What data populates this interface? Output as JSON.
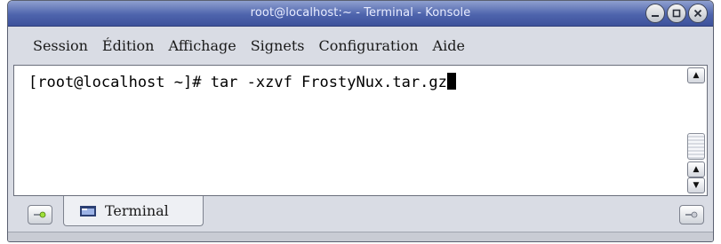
{
  "window": {
    "title": "root@localhost:~ - Terminal - Konsole",
    "controls": {
      "minimize_icon": "minimize-icon",
      "maximize_icon": "maximize-icon",
      "close_icon": "close-icon"
    }
  },
  "menubar": {
    "items": [
      {
        "label": "Session"
      },
      {
        "label": "Édition"
      },
      {
        "label": "Affichage"
      },
      {
        "label": "Signets"
      },
      {
        "label": "Configuration"
      },
      {
        "label": "Aide"
      }
    ]
  },
  "terminal": {
    "prompt": "[root@localhost ~]# ",
    "command": "tar -xzvf FrostyNux.tar.gz"
  },
  "tabs": {
    "active_label": "Terminal",
    "icon": "terminal-icon"
  },
  "colors": {
    "titlebar": "#4e64ad",
    "window_bg": "#d9dce4",
    "terminal_bg": "#ffffff"
  }
}
